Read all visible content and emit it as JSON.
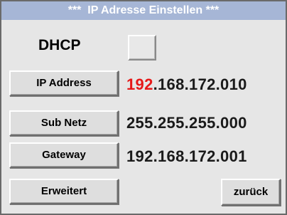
{
  "title": "***  IP Adresse Einstellen ***",
  "dhcp": {
    "label": "DHCP",
    "checked": false
  },
  "ip_address": {
    "button_label": "IP Address",
    "value_highlight": "192",
    "value_rest": ".168.172.010",
    "highlight_color": "#e61818"
  },
  "subnet": {
    "button_label": "Sub Netz",
    "value": "255.255.255.000"
  },
  "gateway": {
    "button_label": "Gateway",
    "value": "192.168.172.001"
  },
  "buttons": {
    "advanced": "Erweitert",
    "back": "zurück"
  },
  "colors": {
    "titlebar": "#a6b6d6",
    "background": "#e6e6e6"
  }
}
